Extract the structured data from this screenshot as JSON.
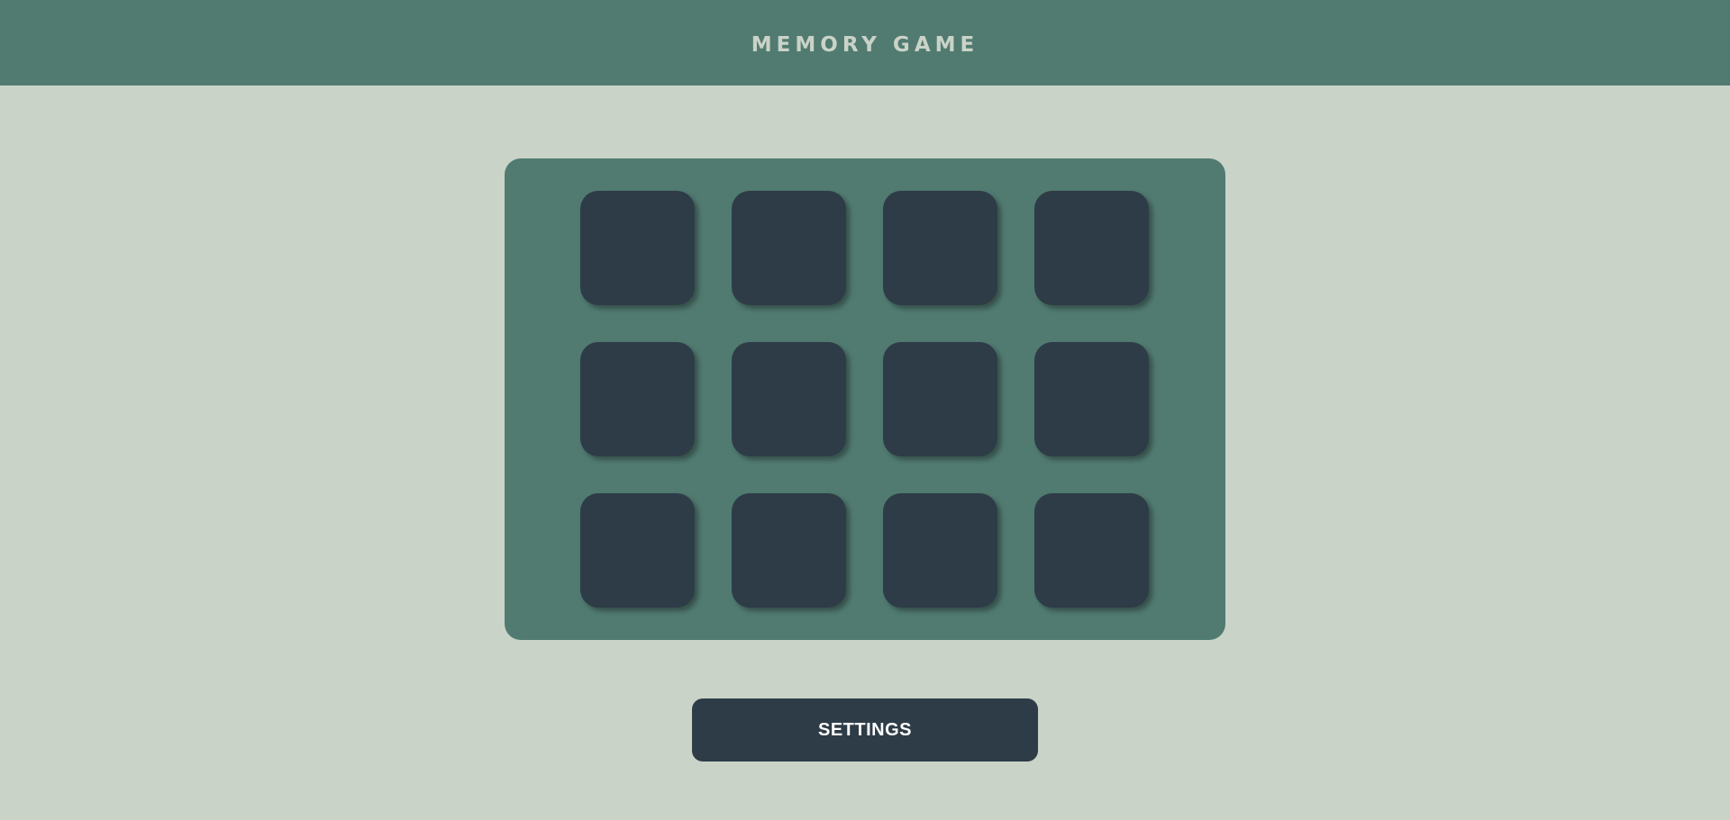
{
  "header": {
    "title": "MEMORY GAME"
  },
  "board": {
    "rows": 3,
    "columns": 4,
    "cards": [
      {
        "state": "face-down"
      },
      {
        "state": "face-down"
      },
      {
        "state": "face-down"
      },
      {
        "state": "face-down"
      },
      {
        "state": "face-down"
      },
      {
        "state": "face-down"
      },
      {
        "state": "face-down"
      },
      {
        "state": "face-down"
      },
      {
        "state": "face-down"
      },
      {
        "state": "face-down"
      },
      {
        "state": "face-down"
      },
      {
        "state": "face-down"
      }
    ]
  },
  "controls": {
    "settings_label": "SETTINGS"
  },
  "colors": {
    "background": "#cad3c8",
    "header": "#517b71",
    "board": "#517b71",
    "card_back": "#2e3c47",
    "button": "#2e3c47",
    "button_text": "#ffffff"
  }
}
